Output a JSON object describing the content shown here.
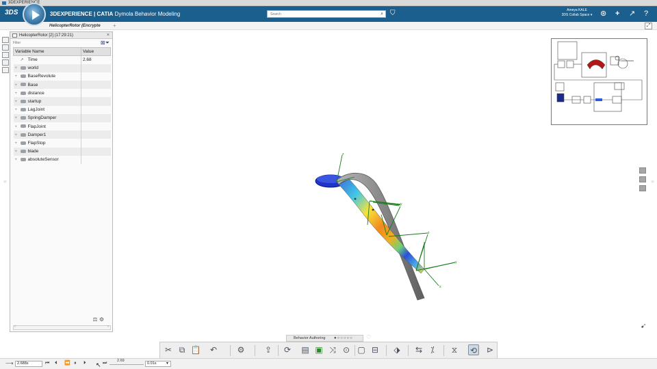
{
  "window": {
    "title": "3DEXPERIENCE"
  },
  "topbar": {
    "brand": "3DS",
    "product": "3DEXPERIENCE | ",
    "app_bold": "CATIA",
    "app_name": " Dymola Behavior Modeling",
    "search_placeholder": "Search",
    "user_name": "Ameya KALE",
    "user_space": "3DS Collab Space ▾"
  },
  "tabbar": {
    "tab_label": "HelicopterRotor (Encrypte"
  },
  "variables_panel": {
    "title": "HelicopterRotor [2] (17:29:21)",
    "filter_placeholder": "Filter",
    "col_name": "Variable Name",
    "col_value": "Value",
    "rows": [
      {
        "name": "Time",
        "value": "2.68"
      },
      {
        "name": "world",
        "value": ""
      },
      {
        "name": "BaseRevolute",
        "value": ""
      },
      {
        "name": "Base",
        "value": ""
      },
      {
        "name": "distance",
        "value": ""
      },
      {
        "name": "startup",
        "value": ""
      },
      {
        "name": "LagJoint",
        "value": ""
      },
      {
        "name": "SpringDamper",
        "value": ""
      },
      {
        "name": "FlapJoint",
        "value": ""
      },
      {
        "name": "Damper1",
        "value": ""
      },
      {
        "name": "FlapStop",
        "value": ""
      },
      {
        "name": "blade",
        "value": ""
      },
      {
        "name": "absoluteSensor",
        "value": ""
      }
    ]
  },
  "viewer": {
    "axis_labels": {
      "x": "x",
      "y": "y",
      "z": "z"
    }
  },
  "section_bar": {
    "label": "Behavior Authoring"
  },
  "player": {
    "time_value": "2.688s",
    "slider_value": "2.69",
    "step_value": "0.01s"
  },
  "colors": {
    "topbar": "#1b5f8e",
    "blade_grey": "#8f8f8f",
    "disc_blue": "#1f35c8",
    "frame_green": "#1a7a1a"
  }
}
